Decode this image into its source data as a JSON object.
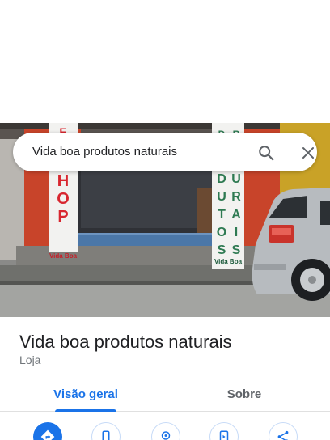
{
  "search": {
    "query": "Vida boa produtos naturais"
  },
  "place": {
    "name": "Vida boa produtos naturais",
    "category": "Loja"
  },
  "tabs": [
    {
      "label": "Visão geral",
      "active": true
    },
    {
      "label": "Sobre",
      "active": false
    }
  ],
  "photo": {
    "banner_left_text": "SHOP",
    "banner_left_brand": "Vida Boa",
    "banner_right_col1": "DUTOS",
    "banner_right_col2": "URAIS",
    "banner_right_brand": "Vida Boa"
  },
  "actions": [
    {
      "icon": "directions-icon",
      "style": "primary"
    },
    {
      "icon": "phone-icon",
      "style": "outline"
    },
    {
      "icon": "save-icon",
      "style": "outline"
    },
    {
      "icon": "send-to-phone-icon",
      "style": "outline"
    },
    {
      "icon": "share-icon",
      "style": "outline"
    }
  ],
  "colors": {
    "accent": "#1a73e8",
    "title": "#202124",
    "secondary": "#70757a",
    "wall_red": "#c8442a",
    "banner_red": "#d8262f",
    "banner_green": "#2e7a52"
  }
}
